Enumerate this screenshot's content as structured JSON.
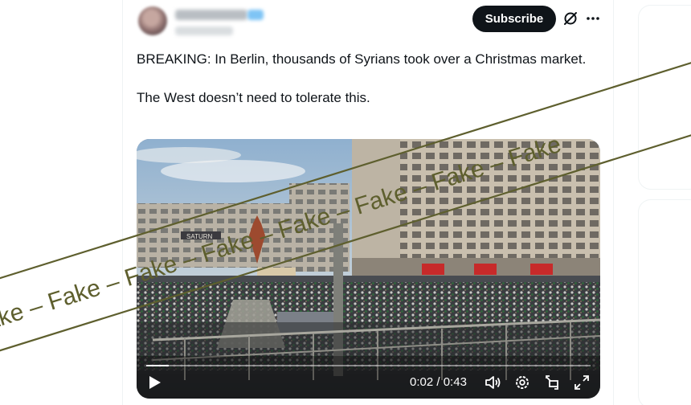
{
  "post": {
    "subscribe_label": "Subscribe",
    "text_line1": "BREAKING: In Berlin, thousands of Syrians took over a Christmas market.",
    "text_line2": "The West doesn’t need to tolerate this."
  },
  "video": {
    "elapsed": "0:02",
    "separator": " / ",
    "duration": "0:43",
    "progress": 0.05,
    "sign_text": "SATURN"
  },
  "overlay": {
    "stamp_text": "Fake – Fake – Fake – Fake – Fake – Fake – Fake – Fake",
    "color": "#5e5f2e"
  },
  "icons": {
    "grok": "grok-icon",
    "more": "more-icon",
    "play": "play-icon",
    "volume": "volume-icon",
    "settings": "settings-icon",
    "pip": "picture-in-picture-icon",
    "fullscreen": "fullscreen-icon"
  },
  "colors": {
    "subscribe_bg": "#0f1419",
    "text": "#0f1419"
  }
}
